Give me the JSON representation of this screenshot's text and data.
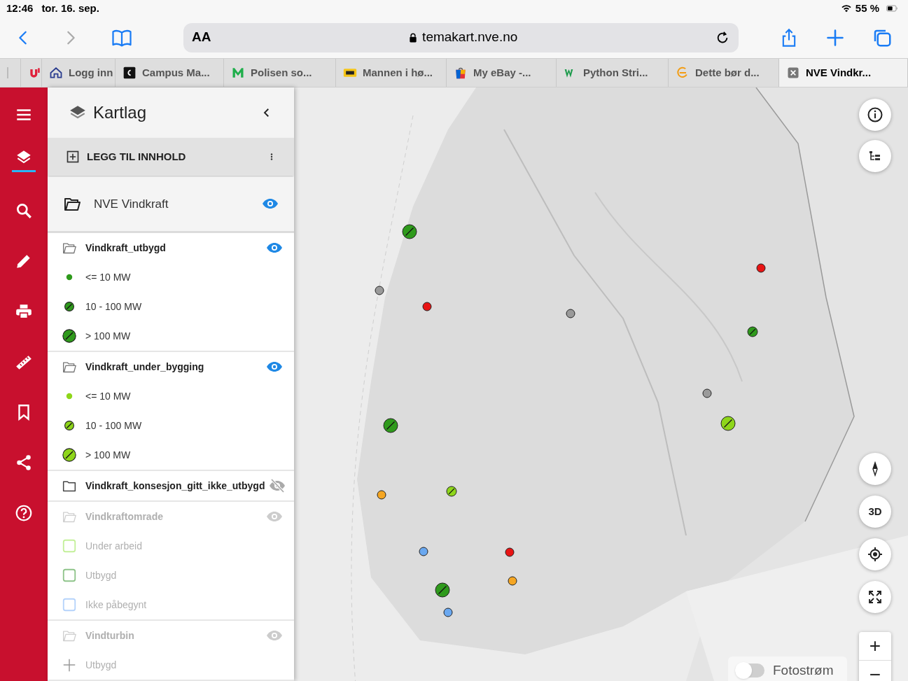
{
  "status_bar": {
    "time": "12:46",
    "date": "tor. 16. sep.",
    "battery": "55 %"
  },
  "toolbar": {
    "text_size": "AA",
    "url": "temakart.nve.no"
  },
  "tabs": [
    {
      "selected": false
    },
    {
      "selected": false
    },
    {
      "label": "Logg inn",
      "selected": false
    },
    {
      "label": "Campus Ma...",
      "selected": false
    },
    {
      "label": "Polisen so...",
      "selected": false
    },
    {
      "label": "Mannen i hø...",
      "selected": false
    },
    {
      "label": "My eBay -...",
      "selected": false
    },
    {
      "label": "Python Stri...",
      "selected": false
    },
    {
      "label": "Dette bør d...",
      "selected": false
    },
    {
      "label": "NVE Vindkr...",
      "selected": true
    }
  ],
  "rail": [
    {
      "selected": true
    },
    {
      "selected": false
    },
    {
      "selected": false
    },
    {
      "selected": false
    },
    {
      "selected": false
    },
    {
      "selected": false
    },
    {
      "selected": false
    },
    {
      "selected": false
    }
  ],
  "panel": {
    "title": "Kartlag",
    "add_button": "LEGG TIL INNHOLD",
    "root": {
      "label": "NVE Vindkraft",
      "visible": true
    },
    "layers": [
      {
        "label": "Vindkraft_utbygd",
        "visible": true,
        "disabled": false,
        "items": [
          {
            "label": "<= 10 MW",
            "kind": "small",
            "color": "#2f9a1c"
          },
          {
            "label": "10 - 100 MW",
            "kind": "medium",
            "color": "#2f9a1c"
          },
          {
            "label": "> 100 MW",
            "kind": "large",
            "color": "#2f9a1c"
          }
        ]
      },
      {
        "label": "Vindkraft_under_bygging",
        "visible": true,
        "disabled": false,
        "items": [
          {
            "label": "<= 10 MW",
            "kind": "small",
            "color": "#8ed61a"
          },
          {
            "label": "10 - 100 MW",
            "kind": "medium",
            "color": "#8ed61a"
          },
          {
            "label": "> 100 MW",
            "kind": "large",
            "color": "#8ed61a"
          }
        ]
      },
      {
        "label": "Vindkraft_konsesjon_gitt_ikke_utbygd",
        "visible": false,
        "disabled": false
      },
      {
        "label": "Vindkraftomrade",
        "visible": true,
        "disabled": true,
        "items": [
          {
            "label": "Under arbeid",
            "kind": "square",
            "color": "#c4f09a"
          },
          {
            "label": "Utbygd",
            "kind": "square",
            "color": "#8fc48a"
          },
          {
            "label": "Ikke påbegynt",
            "kind": "square",
            "color": "#b5d3fb"
          }
        ]
      },
      {
        "label": "Vindturbin",
        "visible": true,
        "disabled": true,
        "items": [
          {
            "label": "Utbygd",
            "kind": "turbine"
          }
        ]
      }
    ]
  },
  "map": {
    "markers": [
      {
        "kind": "large",
        "color": "#2f9a1c"
      },
      {
        "kind": "large",
        "color": "#2f9a1c"
      },
      {
        "kind": "large",
        "color": "#2f9a1c"
      },
      {
        "kind": "large",
        "color": "#8ed61a"
      },
      {
        "kind": "medium",
        "color": "#2f9a1c"
      },
      {
        "kind": "medium",
        "color": "#8ed61a"
      },
      {
        "kind": "plain",
        "color": "#e81414"
      },
      {
        "kind": "plain",
        "color": "#e81414"
      },
      {
        "kind": "plain",
        "color": "#e81414"
      },
      {
        "kind": "plain",
        "color": "#f5a623"
      },
      {
        "kind": "plain",
        "color": "#f5a623"
      },
      {
        "kind": "plain",
        "color": "#6aa8f0"
      },
      {
        "kind": "plain",
        "color": "#6aa8f0"
      },
      {
        "kind": "plain",
        "color": "#9a9a9a"
      },
      {
        "kind": "plain",
        "color": "#9a9a9a"
      },
      {
        "kind": "plain",
        "color": "#9a9a9a"
      }
    ],
    "controls": [
      {
        "kind": "info"
      },
      {
        "kind": "tree"
      },
      {
        "kind": "compass"
      },
      {
        "kind": "text",
        "label": "3D"
      },
      {
        "kind": "locate"
      },
      {
        "kind": "fullscreen"
      }
    ],
    "zoom": [
      {
        "label": "+"
      },
      {
        "label": "−"
      }
    ],
    "photostream": {
      "label": "Fotostrøm",
      "on": false
    }
  }
}
